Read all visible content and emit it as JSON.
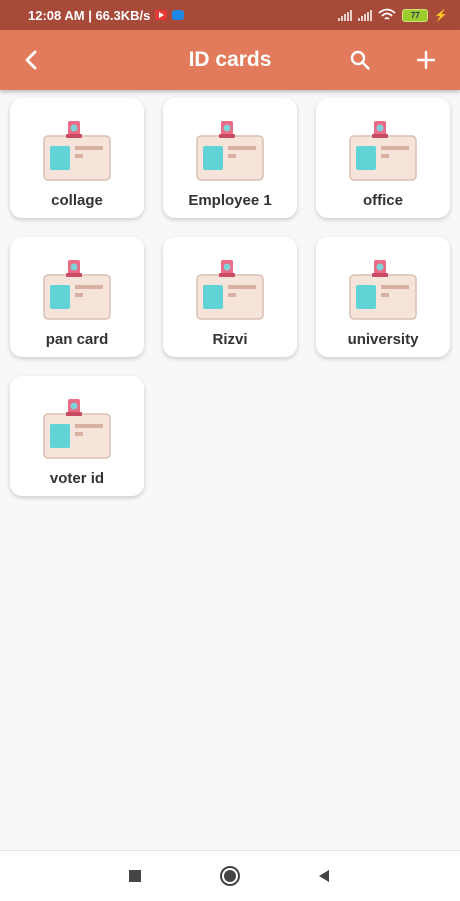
{
  "status_bar": {
    "time_speed": "12:08 AM | 66.3KB/s",
    "battery": "77"
  },
  "app_bar": {
    "title": "ID cards",
    "back_icon": "chevron-left-icon",
    "search_icon": "search-icon",
    "add_icon": "plus-icon"
  },
  "cards": [
    {
      "label": "collage"
    },
    {
      "label": "Employee 1"
    },
    {
      "label": "office"
    },
    {
      "label": "pan card"
    },
    {
      "label": "Rizvi"
    },
    {
      "label": "university"
    },
    {
      "label": "voter id"
    }
  ],
  "colors": {
    "status_bar": "#a84a3a",
    "app_bar": "#e27a5c",
    "background": "#f7f8fa",
    "card": "#ffffff"
  },
  "nav_bar": {
    "recent_icon": "square-recent-icon",
    "home_icon": "circle-home-icon",
    "back_icon": "triangle-back-icon"
  }
}
